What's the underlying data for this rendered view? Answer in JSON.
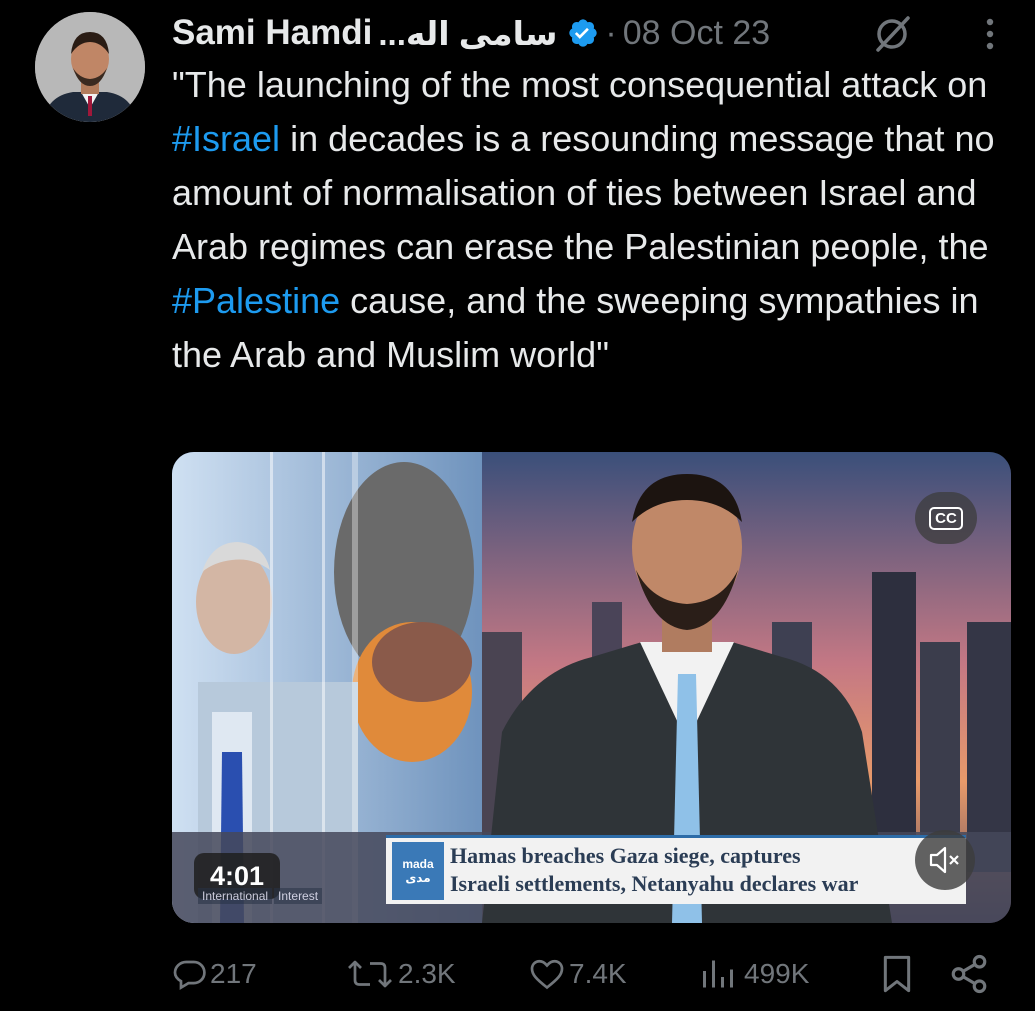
{
  "tweet": {
    "author_name": "Sami Hamdi",
    "author_name_ar": "سامی اله...",
    "dot": "·",
    "date": "08 Oct 23",
    "text_parts": [
      {
        "text": "\"The launching of the most consequential attack on ",
        "type": "text"
      },
      {
        "text": "#Israel",
        "type": "hashtag"
      },
      {
        "text": " in decades is a resounding message that no amount of normalisation of ties between Israel and Arab regimes can erase the Palestinian people, the ",
        "type": "text"
      },
      {
        "text": "#Palestine",
        "type": "hashtag"
      },
      {
        "text": " cause, and the sweeping sympathies in the Arab and Muslim world\"",
        "type": "text"
      }
    ]
  },
  "media": {
    "duration": "4:01",
    "cc_label": "CC",
    "ticker_logo": "mada",
    "ticker_logo_ar": "مدى",
    "ticker_line1": "Hamas breaches Gaza siege, captures",
    "ticker_line2": "Israeli settlements, Netanyahu declares war",
    "brand_tag_1": "International",
    "brand_tag_2": "Interest"
  },
  "actions": {
    "replies": "217",
    "reposts": "2.3K",
    "likes": "7.4K",
    "views": "499K"
  },
  "colors": {
    "background": "#000000",
    "text": "#e7e9ea",
    "muted": "#71767b",
    "link": "#1d9bf0",
    "verified": "#1d9bf0"
  },
  "icons": [
    "verified-badge-icon",
    "grok-icon",
    "more-icon",
    "cc-icon",
    "mute-icon",
    "reply-icon",
    "repost-icon",
    "like-icon",
    "views-icon",
    "bookmark-icon",
    "share-icon"
  ]
}
